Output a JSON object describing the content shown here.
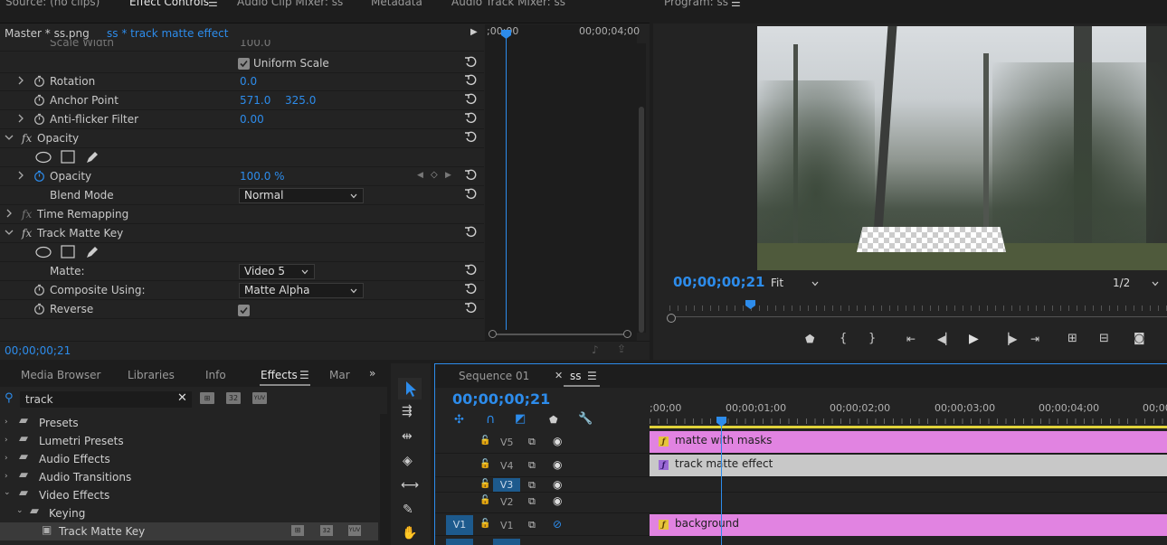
{
  "top_tabs": {
    "source": "Source: (no clips)",
    "effect_controls": "Effect Controls",
    "audio_clip_mixer": "Audio Clip Mixer: ss",
    "metadata": "Metadata",
    "audio_track_mixer": "Audio Track Mixer: ss",
    "program": "Program: ss"
  },
  "effect_controls": {
    "master": "Master * ss.png",
    "sequence_clip": "ss * track matte effect",
    "tc_start": ";00;00",
    "tc_end": "00;00;04;00",
    "rows": {
      "scale_width_label": "Scale Width",
      "scale_width_value": "100.0",
      "uniform_scale_label": "Uniform Scale",
      "rotation_label": "Rotation",
      "rotation_value": "0.0",
      "anchor_label": "Anchor Point",
      "anchor_x": "571.0",
      "anchor_y": "325.0",
      "antiflicker_label": "Anti-flicker Filter",
      "antiflicker_value": "0.00",
      "opacity_group": "Opacity",
      "opacity_label": "Opacity",
      "opacity_value": "100.0 %",
      "blend_label": "Blend Mode",
      "blend_value": "Normal",
      "time_remap": "Time Remapping",
      "track_matte_group": "Track Matte Key",
      "matte_label": "Matte:",
      "matte_value": "Video 5",
      "composite_label": "Composite Using:",
      "composite_value": "Matte Alpha",
      "reverse_label": "Reverse"
    },
    "fx_glyph": "fx",
    "current_time": "00;00;00;21"
  },
  "program": {
    "timecode": "00;00;00;21",
    "fit": "Fit",
    "resolution": "1/2"
  },
  "effects_panel": {
    "tabs": [
      "Media Browser",
      "Libraries",
      "Info",
      "Effects",
      "Mar"
    ],
    "search_value": "track",
    "tree": [
      "Presets",
      "Lumetri Presets",
      "Audio Effects",
      "Audio Transitions",
      "Video Effects",
      "Keying",
      "Track Matte Key"
    ],
    "badge_32": "32",
    "badge_yuv": "YUV"
  },
  "timeline": {
    "tab_sequence": "Sequence 01",
    "tab_ss": "ss",
    "timecode": "00;00;00;21",
    "ruler": [
      ";00;00",
      "00;00;01;00",
      "00;00;02;00",
      "00;00;03;00",
      "00;00;04;00",
      "00;00"
    ],
    "tracks": [
      "V5",
      "V4",
      "V3",
      "V2",
      "V1"
    ],
    "source_patch": "V1",
    "clips": {
      "v5": "matte with masks",
      "v4": "track matte effect",
      "v1": "background"
    },
    "colors": {
      "pink_clip": "#e183e1",
      "gray_clip": "#c8c8c8",
      "accent": "#2d8ceb"
    }
  }
}
